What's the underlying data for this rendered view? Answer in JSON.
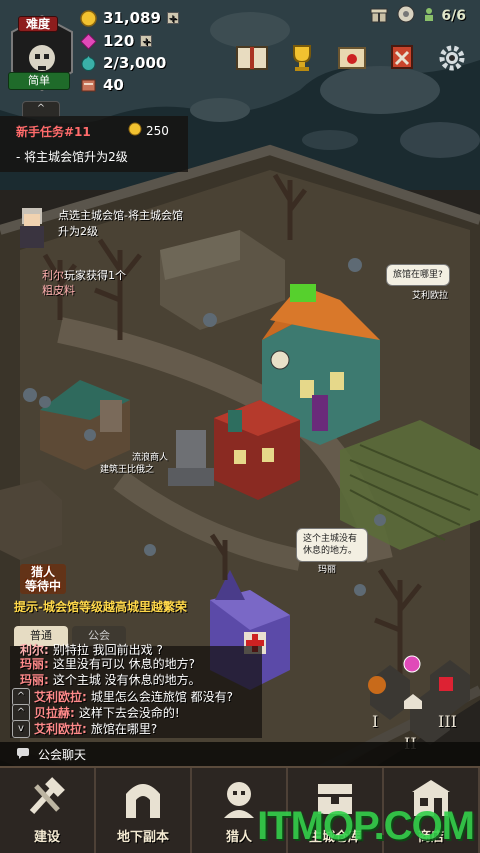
{
  "difficulty": {
    "label": "难度",
    "level": "简单"
  },
  "resources": [
    {
      "icon": "gold-coin-icon",
      "value": "31,089",
      "has_plus": true
    },
    {
      "icon": "gem-icon",
      "value": "120",
      "has_plus": true
    },
    {
      "icon": "soul-orb-icon",
      "value": "2/3,000",
      "has_plus": false
    },
    {
      "icon": "meat-icon",
      "value": "40",
      "has_plus": false
    }
  ],
  "population": "6/6",
  "collapse_label": "^",
  "quest": {
    "title": "新手任务#11",
    "reward": "250",
    "desc": "- 将主城会馆升为2级"
  },
  "npc_hint": "点选主城会馆-将主城会馆升为2级",
  "player_msg": {
    "name": "利尔",
    "text": "玩家获得1个",
    "item": "粗皮料"
  },
  "bubbles": {
    "aili": {
      "text": "旅馆在哪里?",
      "tag": "艾利欧拉"
    },
    "mali": {
      "text": "这个主城没有休息的地方。",
      "tag": "玛丽"
    },
    "liulang": "流浪商人",
    "jianzhu": "建筑王比俄之"
  },
  "hunter_wait": {
    "line1": "猎人",
    "line2": "等待中"
  },
  "tip": "提示-城会馆等级越高城里越繁荣",
  "chat": {
    "tabs": [
      "普通",
      "公会"
    ],
    "lines": [
      {
        "arrow": "",
        "name": "利尔:",
        "text": "别特拉 我回前出戏 ?",
        "color": "#ffb0b0"
      },
      {
        "arrow": "",
        "name": "玛丽:",
        "text": "这里没有可以 休息的地方?",
        "color": "#ff8a8a"
      },
      {
        "arrow": "",
        "name": "玛丽:",
        "text": "这个主城 没有休息的地方。",
        "color": "#ff8a8a"
      },
      {
        "arrow": "^",
        "name": "艾利欧拉:",
        "text": "城里怎么会连旅馆 都没有?",
        "color": "#ff8a8a"
      },
      {
        "arrow": "^",
        "name": "贝拉赫:",
        "text": "这样下去会没命的!",
        "color": "#ff8a8a"
      },
      {
        "arrow": "v",
        "name": "艾利欧拉:",
        "text": "旅馆在哪里?",
        "color": "#ff8a8a"
      }
    ],
    "guild_chat": "公会聊天"
  },
  "side_buttons": [
    "I",
    "II",
    "III"
  ],
  "nav": [
    {
      "icon": "hammer-icon",
      "label": "建设"
    },
    {
      "icon": "dungeon-gate-icon",
      "label": "地下副本"
    },
    {
      "icon": "hunter-icon",
      "label": "猎人"
    },
    {
      "icon": "warehouse-chest-icon",
      "label": "主城仓库"
    },
    {
      "icon": "shop-icon",
      "label": "商店"
    }
  ],
  "watermark": "ITMOP.COM"
}
